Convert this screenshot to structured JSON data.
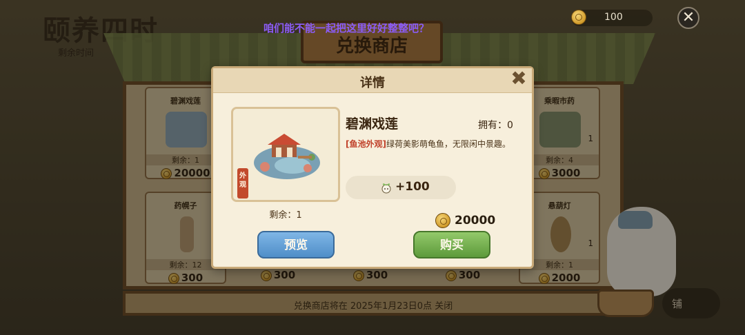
{
  "header": {
    "game_title": "颐养四时",
    "remain_time_label": "剩余时间",
    "marquee": "咱们能不能一起把这里好好整整吧？",
    "currency_amount": "100",
    "close_icon": "close-icon"
  },
  "shop": {
    "title": "兑换商店",
    "footer_notice": "兑换商店将在 2025年1月23日0点 关闭",
    "side_button_label": "铺",
    "items_top": [
      {
        "name": "碧渊戏莲",
        "left": "剩余：1",
        "price": "20000"
      },
      {
        "name": "乘暇市药",
        "left": "剩余：4",
        "price": "3000",
        "qty": "1"
      }
    ],
    "items_bottom": [
      {
        "name": "药幌子",
        "left": "剩余：12",
        "price": "300"
      },
      {
        "name": "",
        "left": "",
        "price": "300"
      },
      {
        "name": "",
        "left": "",
        "price": "300"
      },
      {
        "name": "",
        "left": "",
        "price": "300"
      },
      {
        "name": "悬葫灯",
        "left": "剩余：1",
        "price": "2000",
        "qty": "1"
      }
    ]
  },
  "dialog": {
    "title": "详情",
    "item_name": "碧渊戏莲",
    "owned": "拥有：0",
    "desc_tag": "[鱼池外观]",
    "desc_text": "绿荷美影萌龟鱼，无限闲中景趣。",
    "vertical_tag": "外观",
    "remaining": "剩余：1",
    "reward": "+100",
    "price": "20000",
    "preview_label": "预览",
    "buy_label": "购买"
  },
  "colors": {
    "accent_red": "#c0412a",
    "preview_blue": "#4f8ec8",
    "buy_green": "#5d9a3b",
    "marquee_purple": "#8b5cf6"
  }
}
